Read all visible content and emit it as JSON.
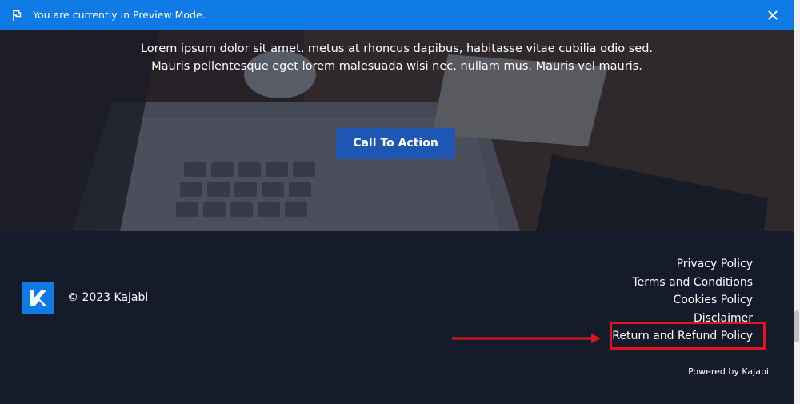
{
  "preview_bar": {
    "message": "You are currently in Preview Mode.",
    "flag_icon": "flag-icon",
    "close_icon": "close-icon"
  },
  "hero": {
    "line1": "Lorem ipsum dolor sit amet, metus at rhoncus dapibus, habitasse vitae cubilia odio sed.",
    "line2": "Mauris pellentesque eget lorem malesuada wisi nec, nullam mus. Mauris vel mauris.",
    "cta_label": "Call To Action"
  },
  "footer": {
    "logo_icon": "kajabi-logo-icon",
    "copyright": "© 2023 Kajabi",
    "links": [
      "Privacy Policy",
      "Terms and Conditions",
      "Cookies Policy",
      "Disclaimer",
      "Return and Refund Policy"
    ],
    "powered_by": "Powered by Kajabi"
  },
  "colors": {
    "banner_blue": "#0f7ae5",
    "footer_bg": "#161b2b",
    "cta_blue": "#1e56b3",
    "annotation_red": "#e0161c"
  }
}
